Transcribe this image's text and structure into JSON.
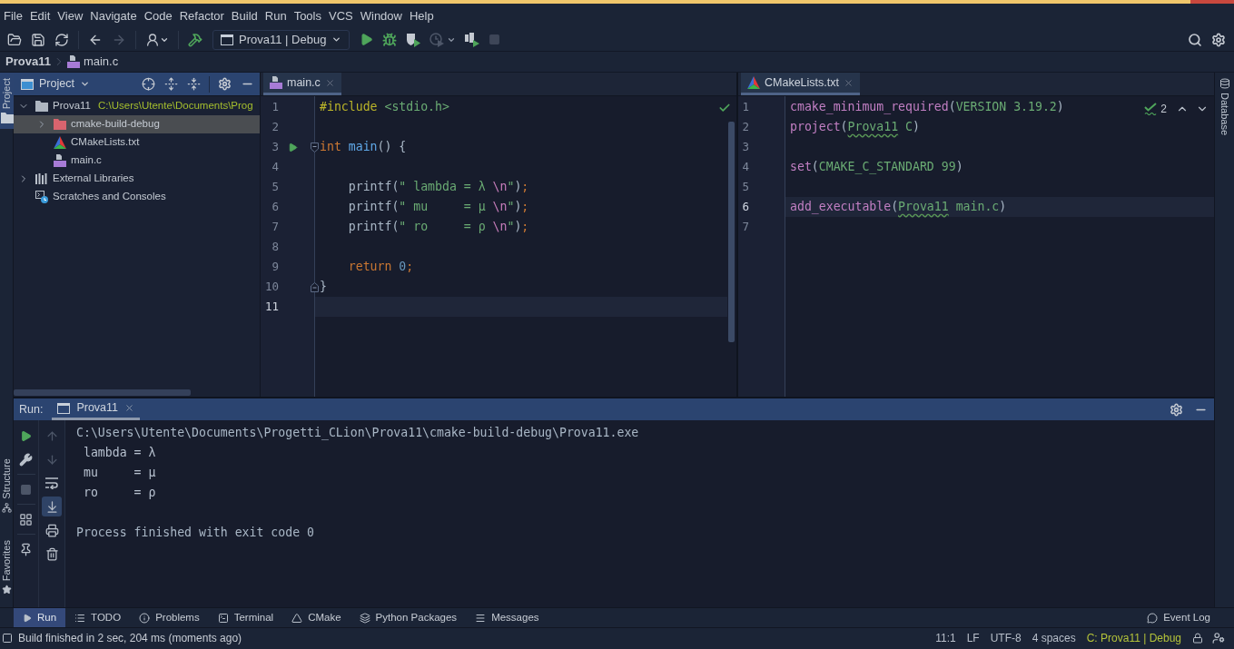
{
  "menu": [
    "File",
    "Edit",
    "View",
    "Navigate",
    "Code",
    "Refactor",
    "Build",
    "Run",
    "Tools",
    "VCS",
    "Window",
    "Help"
  ],
  "toolbar": {
    "items": [
      {
        "kind": "open",
        "disabled": false
      },
      {
        "kind": "save",
        "disabled": false
      },
      {
        "kind": "sync",
        "disabled": false
      },
      {
        "kind": "separator"
      },
      {
        "kind": "back",
        "disabled": false
      },
      {
        "kind": "forward",
        "disabled": true
      },
      {
        "kind": "separator"
      },
      {
        "kind": "vcs_user",
        "disabled": false
      },
      {
        "kind": "separator"
      },
      {
        "kind": "build",
        "disabled": false
      },
      {
        "kind": "run_configuration",
        "label": "Prova11 | Debug",
        "disabled": false
      },
      {
        "kind": "run",
        "disabled": false
      },
      {
        "kind": "debug",
        "disabled": false
      },
      {
        "kind": "coverage",
        "disabled": false
      },
      {
        "kind": "profile",
        "disabled": true
      },
      {
        "kind": "attach",
        "disabled": false
      },
      {
        "kind": "stop",
        "disabled": true
      }
    ],
    "right": [
      {
        "kind": "search",
        "disabled": false
      },
      {
        "kind": "settings",
        "disabled": false
      }
    ]
  },
  "breadcrumb": [
    {
      "label": "Prova11",
      "kind": "project"
    },
    {
      "label": "main.c",
      "kind": "c_file"
    }
  ],
  "left_stripe": {
    "top": [
      {
        "label": "Project",
        "kind": "project",
        "selected": true
      }
    ],
    "bottom": [
      {
        "label": "Structure",
        "kind": "structure",
        "selected": false
      },
      {
        "label": "Favorites",
        "kind": "favorites",
        "selected": false
      }
    ]
  },
  "right_stripe": [
    {
      "label": "Database",
      "kind": "database",
      "selected": false
    }
  ],
  "project_panel": {
    "title": "Project",
    "tree": [
      {
        "label": "Prova11",
        "kind": "module",
        "detail": "C:\\Users\\Utente\\Documents\\Prog",
        "expanded": true,
        "selected": false,
        "children": [
          {
            "label": "cmake-build-debug",
            "kind": "excluded_folder",
            "expanded": false,
            "selected": true
          },
          {
            "label": "CMakeLists.txt",
            "kind": "cmake_file",
            "selected": false
          },
          {
            "label": "main.c",
            "kind": "c_file",
            "selected": false
          }
        ]
      },
      {
        "label": "External Libraries",
        "kind": "libraries",
        "expanded": false,
        "selected": false
      },
      {
        "label": "Scratches and Consoles",
        "kind": "scratches",
        "selected": false
      }
    ]
  },
  "editors": [
    {
      "tab": {
        "label": "main.c",
        "kind": "c_file",
        "selected": true
      },
      "inspection": {
        "kind": "ok"
      },
      "lines": [
        {
          "number": "1",
          "kind": "code",
          "current": false,
          "tokens": [
            {
              "kind": "directive",
              "text": "#include"
            },
            {
              "kind": "header",
              "text": " <stdio.h>"
            }
          ]
        },
        {
          "number": "2",
          "kind": "code",
          "current": false
        },
        {
          "number": "3",
          "kind": "function_start",
          "current": false,
          "tokens": [
            {
              "kind": "keyword",
              "text": "int"
            },
            {
              "kind": "function",
              "text": " main"
            },
            {
              "kind": "plain",
              "text": "() {"
            }
          ]
        },
        {
          "number": "4",
          "kind": "code",
          "current": false
        },
        {
          "number": "5",
          "kind": "code",
          "current": false,
          "tokens": [
            {
              "kind": "plain",
              "text": "    printf("
            },
            {
              "kind": "string",
              "text": "\" lambda = λ "
            },
            {
              "kind": "escape",
              "text": "\\n"
            },
            {
              "kind": "string",
              "text": "\""
            },
            {
              "kind": "plain",
              "text": ")"
            },
            {
              "kind": "semicolon",
              "text": ";"
            }
          ]
        },
        {
          "number": "6",
          "kind": "code",
          "current": false,
          "tokens": [
            {
              "kind": "plain",
              "text": "    printf("
            },
            {
              "kind": "string",
              "text": "\" mu     = μ "
            },
            {
              "kind": "escape",
              "text": "\\n"
            },
            {
              "kind": "string",
              "text": "\""
            },
            {
              "kind": "plain",
              "text": ")"
            },
            {
              "kind": "semicolon",
              "text": ";"
            }
          ]
        },
        {
          "number": "7",
          "kind": "code",
          "current": false,
          "tokens": [
            {
              "kind": "plain",
              "text": "    printf("
            },
            {
              "kind": "string",
              "text": "\" ro     = ρ "
            },
            {
              "kind": "escape",
              "text": "\\n"
            },
            {
              "kind": "string",
              "text": "\""
            },
            {
              "kind": "plain",
              "text": ")"
            },
            {
              "kind": "semicolon",
              "text": ";"
            }
          ]
        },
        {
          "number": "8",
          "kind": "code",
          "current": false
        },
        {
          "number": "9",
          "kind": "code",
          "current": false,
          "tokens": [
            {
              "kind": "keyword",
              "text": "    return"
            },
            {
              "kind": "number",
              "text": " 0"
            },
            {
              "kind": "semicolon",
              "text": ";"
            }
          ]
        },
        {
          "number": "10",
          "kind": "block_end",
          "current": false,
          "tokens": [
            {
              "kind": "plain",
              "text": "}"
            }
          ]
        },
        {
          "number": "11",
          "kind": "code",
          "current": true
        }
      ]
    },
    {
      "tab": {
        "label": "CMakeLists.txt",
        "kind": "cmake_file",
        "selected": true
      },
      "inspection": {
        "kind": "typos",
        "count": "2"
      },
      "lines": [
        {
          "number": "1",
          "kind": "code",
          "current": false,
          "tokens": [
            {
              "kind": "command",
              "text": "cmake_minimum_required"
            },
            {
              "kind": "plain",
              "text": "("
            },
            {
              "kind": "arg",
              "text": "VERSION 3.19.2"
            },
            {
              "kind": "plain",
              "text": ")"
            }
          ]
        },
        {
          "number": "2",
          "kind": "code",
          "current": false,
          "tokens": [
            {
              "kind": "command",
              "text": "project"
            },
            {
              "kind": "plain",
              "text": "("
            },
            {
              "kind": "typo",
              "text": "Prova11"
            },
            {
              "kind": "arg",
              "text": " C"
            },
            {
              "kind": "plain",
              "text": ")"
            }
          ]
        },
        {
          "number": "3",
          "kind": "code",
          "current": false
        },
        {
          "number": "4",
          "kind": "code",
          "current": false,
          "tokens": [
            {
              "kind": "command",
              "text": "set"
            },
            {
              "kind": "plain",
              "text": "("
            },
            {
              "kind": "arg",
              "text": "CMAKE_C_STANDARD 99"
            },
            {
              "kind": "plain",
              "text": ")"
            }
          ]
        },
        {
          "number": "5",
          "kind": "code",
          "current": false
        },
        {
          "number": "6",
          "kind": "code",
          "current": true,
          "tokens": [
            {
              "kind": "command",
              "text": "add_executable"
            },
            {
              "kind": "plain",
              "text": "("
            },
            {
              "kind": "typo",
              "text": "Prova11"
            },
            {
              "kind": "arg",
              "text": " main.c"
            },
            {
              "kind": "plain",
              "text": ")"
            }
          ]
        },
        {
          "number": "7",
          "kind": "code",
          "current": false
        }
      ]
    }
  ],
  "run_panel": {
    "label": "Run:",
    "tabs": [
      {
        "label": "Prova11",
        "selected": true
      }
    ],
    "toolbar": [
      {
        "kind": "rerun",
        "disabled": false
      },
      {
        "kind": "edit_config",
        "disabled": false
      },
      {
        "kind": "separator"
      },
      {
        "kind": "stop",
        "disabled": true
      },
      {
        "kind": "separator"
      },
      {
        "kind": "layout",
        "disabled": false
      },
      {
        "kind": "separator"
      },
      {
        "kind": "pin",
        "disabled": false
      }
    ],
    "actions": [
      {
        "kind": "up",
        "disabled": true,
        "on": false
      },
      {
        "kind": "down",
        "disabled": true,
        "on": false
      },
      {
        "kind": "soft_wrap",
        "disabled": false,
        "on": false
      },
      {
        "kind": "scroll_to_end",
        "disabled": false,
        "on": true
      },
      {
        "kind": "print",
        "disabled": false,
        "on": false
      },
      {
        "kind": "clear",
        "disabled": false,
        "on": false
      }
    ],
    "output": [
      {
        "kind": "command",
        "text": "C:\\Users\\Utente\\Documents\\Progetti_CLion\\Prova11\\cmake-build-debug\\Prova11.exe"
      },
      {
        "kind": "stdout",
        "text": " lambda = λ"
      },
      {
        "kind": "stdout",
        "text": " mu     = μ"
      },
      {
        "kind": "stdout",
        "text": " ro     = ρ"
      },
      {
        "kind": "exit",
        "text": "Process finished with exit code 0"
      }
    ]
  },
  "tool_window_bar": {
    "tabs": [
      {
        "label": "Run",
        "kind": "run",
        "selected": true
      },
      {
        "label": "TODO",
        "kind": "todo",
        "selected": false
      },
      {
        "label": "Problems",
        "kind": "problems",
        "selected": false
      },
      {
        "label": "Terminal",
        "kind": "terminal",
        "selected": false
      },
      {
        "label": "CMake",
        "kind": "cmake",
        "selected": false
      },
      {
        "label": "Python Packages",
        "kind": "packages",
        "selected": false
      },
      {
        "label": "Messages",
        "kind": "messages",
        "selected": false
      }
    ],
    "right": [
      {
        "label": "Event Log",
        "kind": "event_log",
        "selected": false
      }
    ]
  },
  "status_bar": {
    "message": "Build finished in 2 sec, 204 ms (moments ago)",
    "items": [
      {
        "label": "11:1",
        "kind": "position"
      },
      {
        "label": "LF",
        "kind": "line_separator"
      },
      {
        "label": "UTF-8",
        "kind": "encoding"
      },
      {
        "label": "4 spaces",
        "kind": "indent"
      },
      {
        "label": "C: Prova11 | Debug",
        "kind": "context"
      }
    ]
  }
}
